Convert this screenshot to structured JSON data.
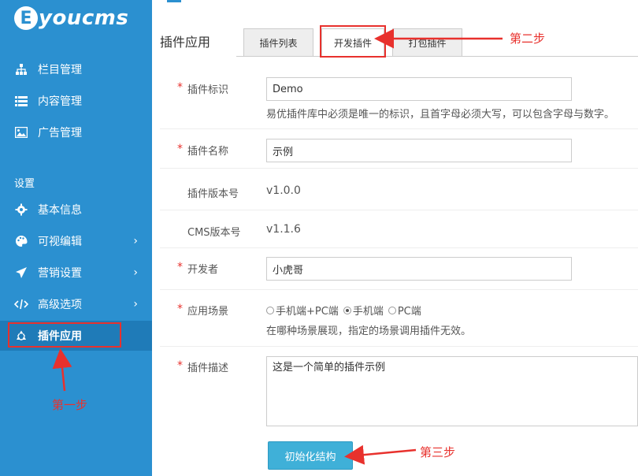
{
  "logo": {
    "e": "E",
    "text": "youcms"
  },
  "sidebar": {
    "items": [
      {
        "label": "栏目管理",
        "icon": "sitemap-icon"
      },
      {
        "label": "内容管理",
        "icon": "list-icon"
      },
      {
        "label": "广告管理",
        "icon": "image-icon"
      }
    ],
    "section": "设置",
    "settings": [
      {
        "label": "基本信息",
        "icon": "gear-icon"
      },
      {
        "label": "可视编辑",
        "icon": "palette-icon"
      },
      {
        "label": "营销设置",
        "icon": "paper-plane-icon"
      },
      {
        "label": "高级选项",
        "icon": "code-icon"
      },
      {
        "label": "插件应用",
        "icon": "recycle-icon"
      }
    ],
    "chevron": "›"
  },
  "header": {
    "title": "插件应用",
    "tabs": [
      {
        "label": "插件列表"
      },
      {
        "label": "开发插件"
      },
      {
        "label": "打包插件"
      }
    ]
  },
  "form": {
    "identifier": {
      "label": "插件标识",
      "value": "Demo",
      "hint": "易优插件库中必须是唯一的标识，且首字母必须大写，可以包含字母与数字。"
    },
    "name": {
      "label": "插件名称",
      "value": "示例"
    },
    "version": {
      "label": "插件版本号",
      "value": "v1.0.0"
    },
    "cms_version": {
      "label": "CMS版本号",
      "value": "v1.1.6"
    },
    "developer": {
      "label": "开发者",
      "value": "小虎哥"
    },
    "scene": {
      "label": "应用场景",
      "options": [
        "手机端+PC端",
        "手机端",
        "PC端"
      ],
      "selected": 1,
      "hint": "在哪种场景展现，指定的场景调用插件无效。"
    },
    "description": {
      "label": "插件描述",
      "value": "这是一个简单的插件示例"
    },
    "submit_label": "初始化结构",
    "required_mark": "*"
  },
  "annotations": {
    "step1": "第一步",
    "step2": "第二步",
    "step3": "第三步",
    "color": "#e8312d"
  }
}
